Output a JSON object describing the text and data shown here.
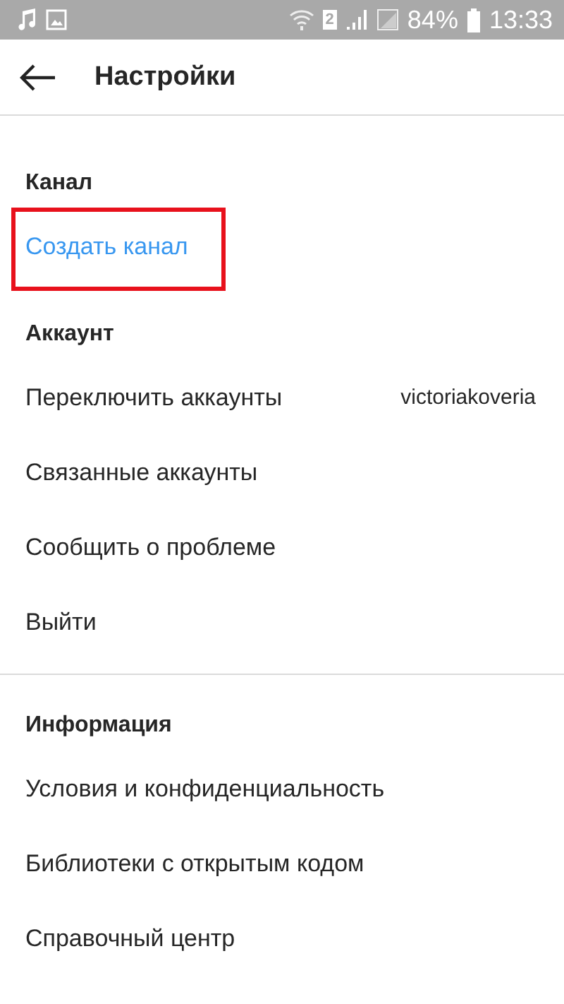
{
  "status_bar": {
    "sim": "2",
    "battery": "84%",
    "time": "13:33"
  },
  "header": {
    "title": "Настройки"
  },
  "sections": [
    {
      "title": "Канал",
      "divider": false,
      "items": [
        {
          "label": "Создать канал",
          "kind": "link",
          "highlighted": true
        }
      ]
    },
    {
      "title": "Аккаунт",
      "divider": true,
      "items": [
        {
          "label": "Переключить аккаунты",
          "value": "victoriakoveria",
          "kind": "normal",
          "highlighted": false
        },
        {
          "label": "Связанные аккаунты",
          "kind": "normal",
          "highlighted": false
        },
        {
          "label": "Сообщить о проблеме",
          "kind": "normal",
          "highlighted": false
        },
        {
          "label": "Выйти",
          "kind": "normal",
          "highlighted": false
        }
      ]
    },
    {
      "title": "Информация",
      "divider": false,
      "items": [
        {
          "label": "Условия и конфиденциальность",
          "kind": "normal",
          "highlighted": false
        },
        {
          "label": "Библиотеки с открытым кодом",
          "kind": "normal",
          "highlighted": false
        },
        {
          "label": "Справочный центр",
          "kind": "normal",
          "highlighted": false
        }
      ]
    }
  ]
}
